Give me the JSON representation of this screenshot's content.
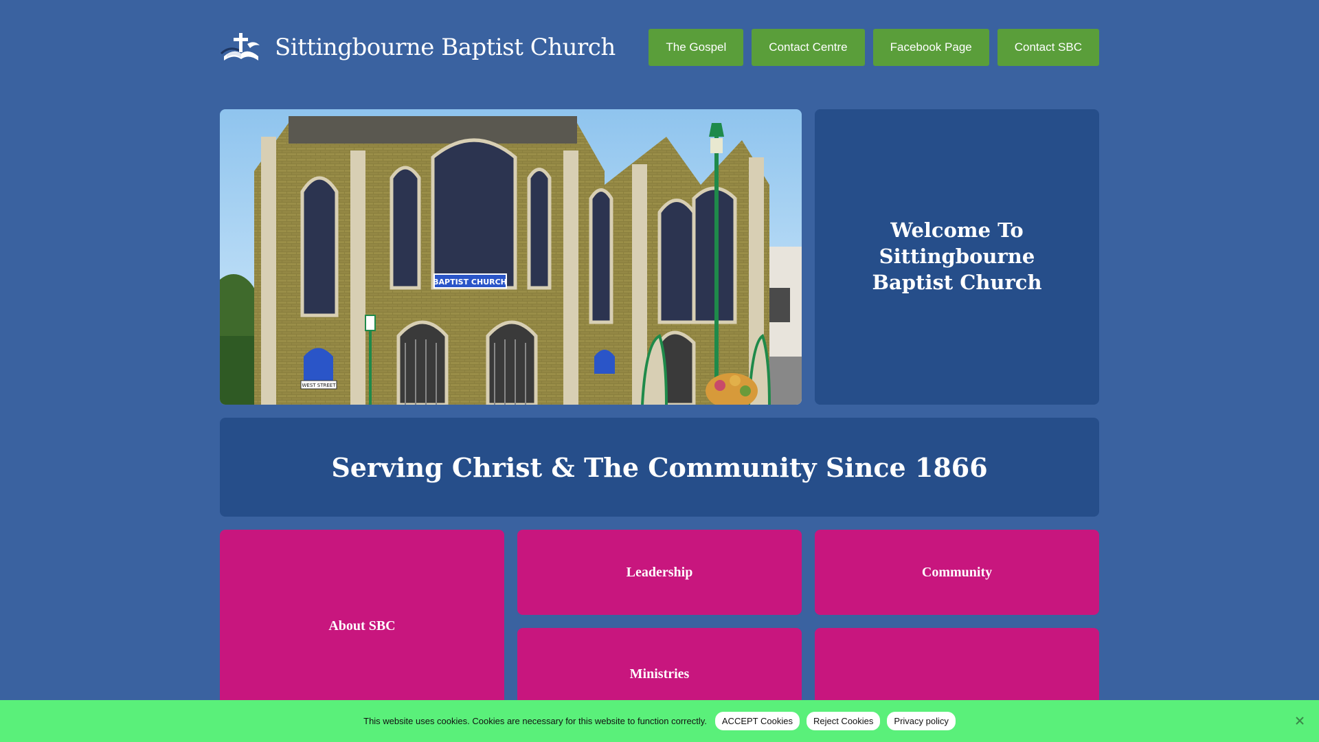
{
  "header": {
    "site_title": "Sittingbourne Baptist Church",
    "logo_icon": "bible-cross-icon",
    "nav": [
      {
        "label": "The Gospel"
      },
      {
        "label": "Contact Centre"
      },
      {
        "label": "Facebook Page"
      },
      {
        "label": "Contact SBC"
      }
    ]
  },
  "hero": {
    "sign_text": "BAPTIST CHURCH",
    "street_sign": "WEST STREET",
    "welcome": "Welcome To Sittingbourne Baptist Church"
  },
  "banner": {
    "text": "Serving Christ & The Community Since 1866"
  },
  "tiles": [
    {
      "label": "About SBC"
    },
    {
      "label": "Leadership"
    },
    {
      "label": "Community"
    },
    {
      "label": "Ministries"
    },
    {
      "label": ""
    }
  ],
  "cookie": {
    "message": "This website uses cookies. Cookies are necessary for this website to function correctly.",
    "accept": "ACCEPT Cookies",
    "reject": "Reject Cookies",
    "privacy": "Privacy policy",
    "close_icon": "close-icon"
  },
  "colors": {
    "background": "#3a62a0",
    "card": "#264e8a",
    "nav_button": "#5a9e3a",
    "tile": "#c8167e",
    "cookie_bar": "#5af07a"
  }
}
